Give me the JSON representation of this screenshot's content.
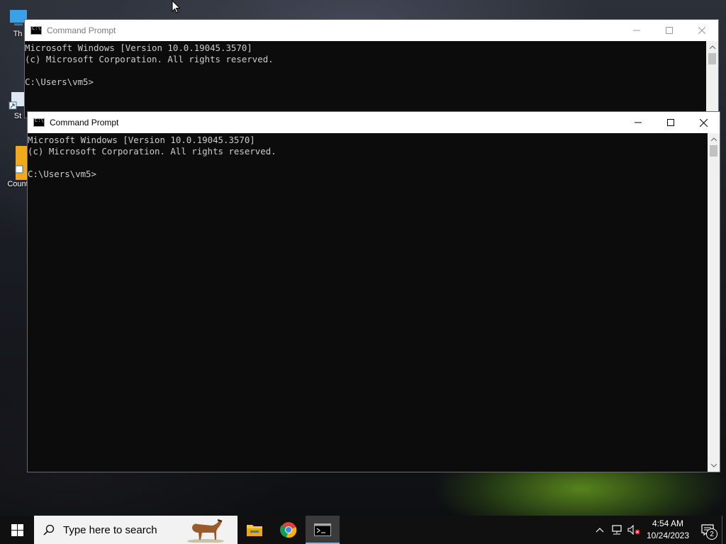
{
  "desktop": {
    "icons": [
      {
        "label": "Th"
      },
      {
        "label": "St"
      },
      {
        "label": "Count"
      }
    ]
  },
  "windows": [
    {
      "title": "Command Prompt",
      "lines": [
        "Microsoft Windows [Version 10.0.19045.3570]",
        "(c) Microsoft Corporation. All rights reserved.",
        "",
        "C:\\Users\\vm5>"
      ]
    },
    {
      "title": "Command Prompt",
      "lines": [
        "Microsoft Windows [Version 10.0.19045.3570]",
        "(c) Microsoft Corporation. All rights reserved.",
        "",
        "C:\\Users\\vm5>"
      ]
    }
  ],
  "taskbar": {
    "search_placeholder": "Type here to search",
    "apps": [
      "file-explorer-icon",
      "chrome-icon",
      "command-prompt-icon"
    ],
    "time": "4:54 AM",
    "date": "10/24/2023",
    "notification_count": "2"
  },
  "colors": {
    "console_bg": "#0c0c0c",
    "console_text": "#cccccc",
    "taskbar_bg": "#101010",
    "active_indicator": "#76b9ed"
  }
}
